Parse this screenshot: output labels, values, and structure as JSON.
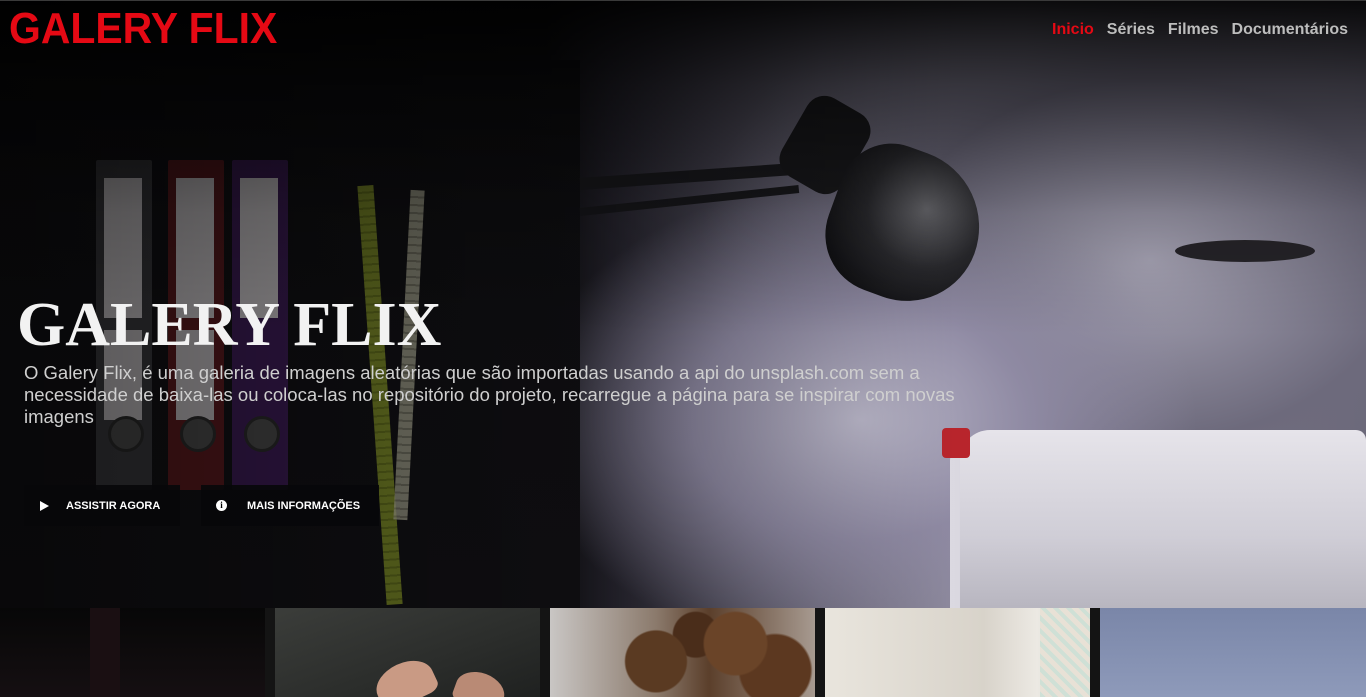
{
  "nav": {
    "logo": "GALERY FLIX",
    "items": [
      {
        "label": "Inicio",
        "active": true
      },
      {
        "label": "Séries",
        "active": false
      },
      {
        "label": "Filmes",
        "active": false
      },
      {
        "label": "Documentários",
        "active": false
      }
    ]
  },
  "hero": {
    "title": "GALERY FLIX",
    "description": "O Galery Flix, é uma galeria de imagens aleatórias que são importadas usando a api do unsplash.com sem a necessidade de baixa-las ou coloca-las no repositório do projeto, recarregue a página para se inspirar com novas imagens",
    "buttons": {
      "play_label": "ASSISTIR AGORA",
      "info_label": "MAIS INFORMAÇÕES"
    }
  },
  "icons": {
    "play": "play-icon",
    "info": "info-icon"
  },
  "colors": {
    "brand": "#e50914",
    "nav_inactive": "#bdbdbd",
    "background": "#141414"
  }
}
